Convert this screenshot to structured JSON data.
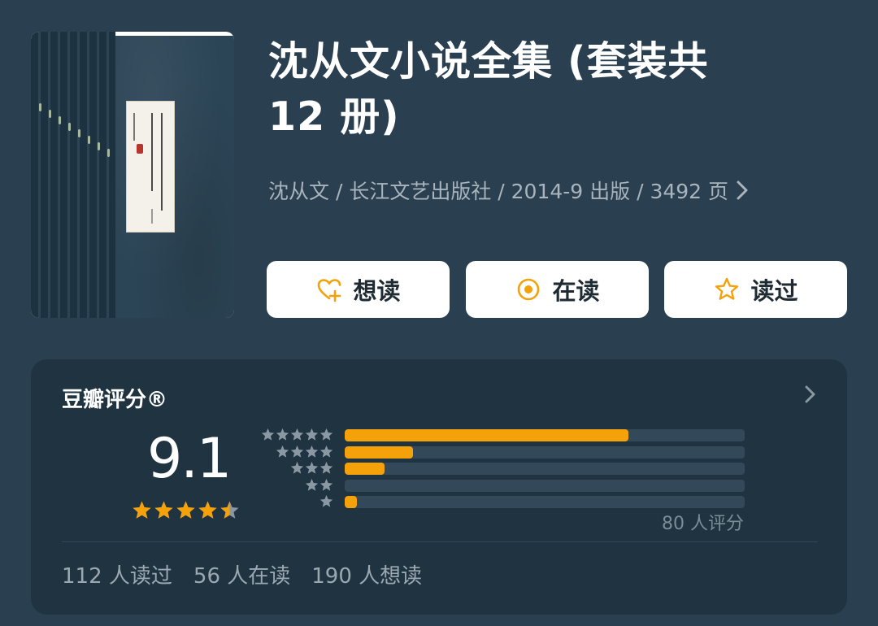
{
  "book": {
    "title_line1": "沈从文小说全集 (套装共",
    "title_line2": "12 册)",
    "meta": "沈从文 / 长江文艺出版社 / 2014-9 出版 / 3492 页",
    "cover_icon": "book-cover-image"
  },
  "actions": [
    {
      "label": "想读",
      "icon": "heart-plus-icon"
    },
    {
      "label": "在读",
      "icon": "target-circle-icon"
    },
    {
      "label": "读过",
      "icon": "star-outline-icon"
    }
  ],
  "rating": {
    "title": "豆瓣评分®",
    "score": "9.1",
    "score_value": 9.1,
    "stars_filled": 4.5,
    "count_text": "80 人评分",
    "distribution": [
      {
        "stars": 5,
        "fraction": 0.71
      },
      {
        "stars": 4,
        "fraction": 0.17
      },
      {
        "stars": 3,
        "fraction": 0.1
      },
      {
        "stars": 2,
        "fraction": 0.0
      },
      {
        "stars": 1,
        "fraction": 0.03
      }
    ]
  },
  "stats": {
    "read": "112 人读过",
    "reading": "56 人在读",
    "want": "190 人想读"
  },
  "colors": {
    "background": "#2a3f4f",
    "card": "#1f3340",
    "accent": "#f4a10a",
    "star_gray": "#8a98a3"
  }
}
